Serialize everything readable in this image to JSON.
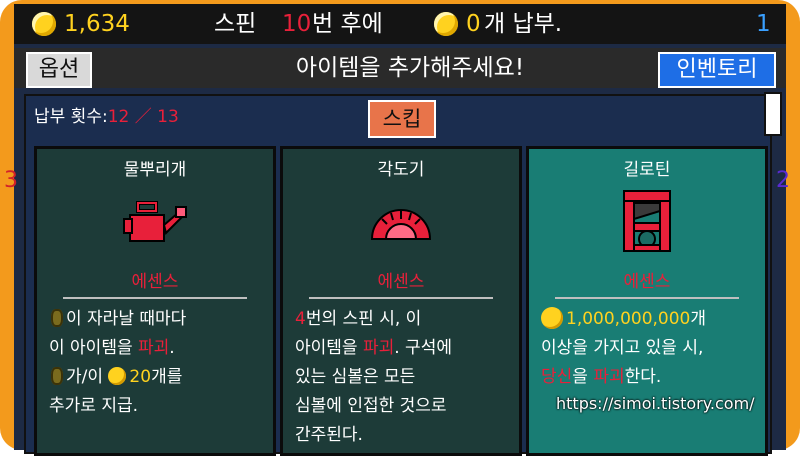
{
  "top": {
    "coins": "1,634",
    "spin_prefix": "스핀",
    "spin_count": "10",
    "spin_suffix": "번 후에",
    "due_amount": "0",
    "due_suffix": "개 납부.",
    "floor": "1"
  },
  "bar": {
    "options_label": "옵션",
    "message": "아이템을 추가해주세요!",
    "inventory_label": "인벤토리"
  },
  "panel": {
    "count_label": "납부 횟수:",
    "count_current": "12",
    "count_total": "13",
    "skip_label": "스킵"
  },
  "cards": [
    {
      "name": "물뿌리개",
      "icon": "watering-can-icon",
      "rarity": "에센스",
      "desc": {
        "l1": "이 자라날 때마다",
        "l2a": "이 아이템을 ",
        "l2b": "파괴",
        "l2c": ".",
        "l3a": "가/이 ",
        "l3b": "20",
        "l3c": "개를",
        "l4": "추가로 지급."
      }
    },
    {
      "name": "각도기",
      "icon": "protractor-icon",
      "rarity": "에센스",
      "desc": {
        "l1a": "4",
        "l1b": "번의 스핀 시, 이",
        "l2a": "아이템을 ",
        "l2b": "파괴",
        "l2c": ". 구석에",
        "l3": "있는 심볼은 모든",
        "l4": "심볼에 인접한 것으로",
        "l5": "간주된다."
      }
    },
    {
      "name": "길로틴",
      "icon": "guillotine-icon",
      "rarity": "에센스",
      "desc": {
        "l1a": "1,000,000,000",
        "l1b": "개",
        "l2": "이상을 가지고 있을 시,",
        "l3a": "당신",
        "l3b": "을 ",
        "l3c": "파괴",
        "l3d": "한다."
      }
    }
  ],
  "side": {
    "left_number": "3",
    "right_number": "2"
  },
  "watermark": "https://simoi.tistory.com/",
  "colors": {
    "accent_red": "#e8203a",
    "coin_yellow": "#ffd21f",
    "inventory_blue": "#1e6ee6",
    "skip_orange": "#e8744a",
    "frame_orange": "#f39a1c"
  }
}
